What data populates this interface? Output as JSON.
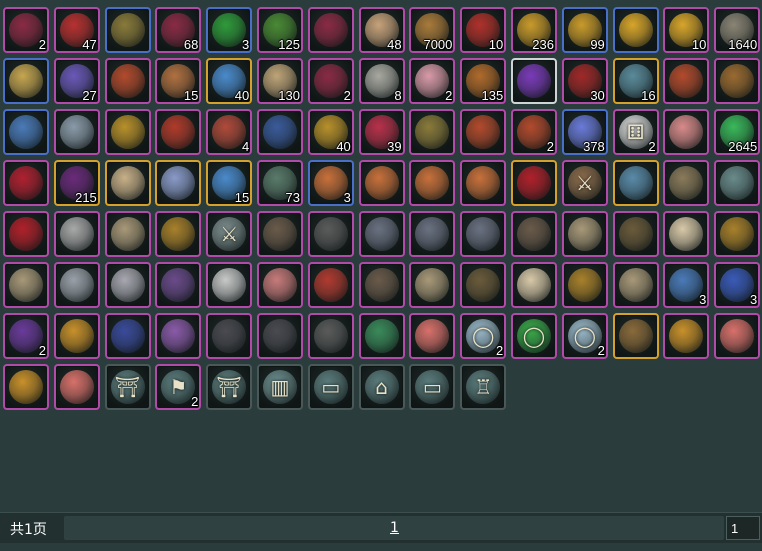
{
  "inventory": {
    "rows": [
      [
        {
          "icon": "purple-seal-icon",
          "quality": "purple",
          "qty": "2"
        },
        {
          "icon": "red-pills-icon",
          "quality": "purple",
          "qty": "47"
        },
        {
          "icon": "scroll-bundle-icon",
          "quality": "blue",
          "qty": ""
        },
        {
          "icon": "purple-seal-icon",
          "quality": "purple",
          "qty": "68"
        },
        {
          "icon": "green-orb-icon",
          "quality": "blue",
          "qty": "3"
        },
        {
          "icon": "herb-sprig-icon",
          "quality": "purple",
          "qty": "125"
        },
        {
          "icon": "purple-seal-icon",
          "quality": "purple",
          "qty": ""
        },
        {
          "icon": "paper-note-icon",
          "quality": "purple",
          "qty": "48"
        },
        {
          "icon": "coin-pouch-icon",
          "quality": "purple",
          "qty": "7000"
        },
        {
          "icon": "red-envelope-icon",
          "quality": "purple",
          "qty": "10"
        },
        {
          "icon": "gold-nuggets-icon",
          "quality": "purple",
          "qty": "236"
        },
        {
          "icon": "gold-nuggets-icon",
          "quality": "blue",
          "qty": "99"
        },
        {
          "icon": "gold-ingot-icon",
          "quality": "blue",
          "qty": ""
        },
        {
          "icon": "gold-ingot-icon",
          "quality": "purple",
          "qty": "10"
        },
        {
          "icon": "stone-block-icon",
          "quality": "purple",
          "qty": "1640"
        }
      ],
      [
        {
          "icon": "flower-wreath-icon",
          "quality": "blue",
          "qty": ""
        },
        {
          "icon": "gem-chest-icon",
          "quality": "purple",
          "qty": "27"
        },
        {
          "icon": "red-treasure-chest-icon",
          "quality": "purple",
          "qty": ""
        },
        {
          "icon": "food-plate-icon",
          "quality": "purple",
          "qty": "15"
        },
        {
          "icon": "blue-crystal-icon",
          "quality": "gold",
          "qty": "40"
        },
        {
          "icon": "scroll-icon",
          "quality": "purple",
          "qty": "130"
        },
        {
          "icon": "purple-seal-icon",
          "quality": "purple",
          "qty": "2"
        },
        {
          "icon": "ore-rock-icon",
          "quality": "purple",
          "qty": "8"
        },
        {
          "icon": "lotus-flower-icon",
          "quality": "purple",
          "qty": "2"
        },
        {
          "icon": "elixir-gourd-icon",
          "quality": "purple",
          "qty": "135"
        },
        {
          "icon": "purple-potion-icon",
          "quality": "white",
          "qty": ""
        },
        {
          "icon": "candied-haws-icon",
          "quality": "purple",
          "qty": "30"
        },
        {
          "icon": "rune-stone-icon",
          "quality": "gold",
          "qty": "16"
        },
        {
          "icon": "red-treasure-chest-icon",
          "quality": "purple",
          "qty": ""
        },
        {
          "icon": "wooden-chest-icon",
          "quality": "purple",
          "qty": ""
        }
      ],
      [
        {
          "icon": "blue-scroll-icon",
          "quality": "blue",
          "qty": ""
        },
        {
          "icon": "silver-pouch-icon",
          "quality": "purple",
          "qty": ""
        },
        {
          "icon": "gourd-bottle-icon",
          "quality": "purple",
          "qty": ""
        },
        {
          "icon": "red-bag-icon",
          "quality": "purple",
          "qty": ""
        },
        {
          "icon": "fox-figurine-icon",
          "quality": "purple",
          "qty": "4"
        },
        {
          "icon": "blue-book-icon",
          "quality": "purple",
          "qty": ""
        },
        {
          "icon": "gold-bars-icon",
          "quality": "purple",
          "qty": "40"
        },
        {
          "icon": "red-gift-box-icon",
          "quality": "purple",
          "qty": "39"
        },
        {
          "icon": "scroll-bundle-icon",
          "quality": "purple",
          "qty": ""
        },
        {
          "icon": "red-treasure-chest-icon",
          "quality": "purple",
          "qty": ""
        },
        {
          "icon": "red-treasure-chest-icon",
          "quality": "purple",
          "qty": "2"
        },
        {
          "icon": "incense-burner-icon",
          "quality": "blue",
          "qty": "378"
        },
        {
          "icon": "dice-icon",
          "quality": "purple",
          "qty": "2"
        },
        {
          "icon": "pink-fish-icon",
          "quality": "purple",
          "qty": ""
        },
        {
          "icon": "jade-bowl-icon",
          "quality": "purple",
          "qty": "2645"
        }
      ],
      [
        {
          "icon": "red-leaf-icon",
          "quality": "purple",
          "qty": ""
        },
        {
          "icon": "gem-shard-icon",
          "quality": "gold",
          "qty": "215"
        },
        {
          "icon": "ancient-scroll-icon",
          "quality": "gold",
          "qty": ""
        },
        {
          "icon": "compass-disc-icon",
          "quality": "gold",
          "qty": ""
        },
        {
          "icon": "blue-crystal-icon",
          "quality": "gold",
          "qty": "15"
        },
        {
          "icon": "stone-mask-icon",
          "quality": "purple",
          "qty": "73"
        },
        {
          "icon": "copper-chest-icon",
          "quality": "blue",
          "qty": "3"
        },
        {
          "icon": "copper-chest-icon",
          "quality": "purple",
          "qty": ""
        },
        {
          "icon": "copper-chest-icon",
          "quality": "purple",
          "qty": ""
        },
        {
          "icon": "copper-chest-icon",
          "quality": "purple",
          "qty": ""
        },
        {
          "icon": "red-claw-weapon-icon",
          "quality": "gold",
          "qty": ""
        },
        {
          "icon": "crossed-blades-icon",
          "quality": "purple",
          "qty": ""
        },
        {
          "icon": "winged-blade-icon",
          "quality": "gold",
          "qty": ""
        },
        {
          "icon": "spiked-weapon-icon",
          "quality": "purple",
          "qty": ""
        },
        {
          "icon": "dagger-icon",
          "quality": "purple",
          "qty": ""
        }
      ],
      [
        {
          "icon": "red-claw-weapon-icon",
          "quality": "purple",
          "qty": ""
        },
        {
          "icon": "spiked-armor-icon",
          "quality": "purple",
          "qty": ""
        },
        {
          "icon": "shoulder-armor-icon",
          "quality": "purple",
          "qty": ""
        },
        {
          "icon": "gold-helmet-icon",
          "quality": "purple",
          "qty": ""
        },
        {
          "icon": "sword-icon",
          "quality": "purple",
          "qty": ""
        },
        {
          "icon": "arm-guard-icon",
          "quality": "purple",
          "qty": ""
        },
        {
          "icon": "dark-belt-icon",
          "quality": "purple",
          "qty": ""
        },
        {
          "icon": "curved-blade-icon",
          "quality": "purple",
          "qty": ""
        },
        {
          "icon": "curved-blade-icon",
          "quality": "purple",
          "qty": ""
        },
        {
          "icon": "curved-blade-icon",
          "quality": "purple",
          "qty": ""
        },
        {
          "icon": "arm-guard-icon",
          "quality": "purple",
          "qty": ""
        },
        {
          "icon": "shoulder-armor-icon",
          "quality": "purple",
          "qty": ""
        },
        {
          "icon": "boots-icon",
          "quality": "purple",
          "qty": ""
        },
        {
          "icon": "white-robe-icon",
          "quality": "purple",
          "qty": ""
        },
        {
          "icon": "gold-bracelet-icon",
          "quality": "purple",
          "qty": ""
        }
      ],
      [
        {
          "icon": "shoulder-armor-icon",
          "quality": "purple",
          "qty": ""
        },
        {
          "icon": "leg-guards-icon",
          "quality": "purple",
          "qty": ""
        },
        {
          "icon": "silver-pauldron-icon",
          "quality": "purple",
          "qty": ""
        },
        {
          "icon": "purple-robe-icon",
          "quality": "purple",
          "qty": ""
        },
        {
          "icon": "white-tunic-icon",
          "quality": "purple",
          "qty": ""
        },
        {
          "icon": "pink-gauntlet-icon",
          "quality": "purple",
          "qty": ""
        },
        {
          "icon": "red-belt-icon",
          "quality": "purple",
          "qty": ""
        },
        {
          "icon": "arm-guard-icon",
          "quality": "purple",
          "qty": ""
        },
        {
          "icon": "shoulder-armor-icon",
          "quality": "purple",
          "qty": ""
        },
        {
          "icon": "boots-icon",
          "quality": "purple",
          "qty": ""
        },
        {
          "icon": "white-robe-icon",
          "quality": "purple",
          "qty": ""
        },
        {
          "icon": "gold-bracelet-icon",
          "quality": "purple",
          "qty": ""
        },
        {
          "icon": "shoulder-armor-icon",
          "quality": "purple",
          "qty": ""
        },
        {
          "icon": "porcelain-vase-icon",
          "quality": "purple",
          "qty": "3"
        },
        {
          "icon": "blue-vase-icon",
          "quality": "purple",
          "qty": "3"
        }
      ],
      [
        {
          "icon": "purple-pouch-icon",
          "quality": "purple",
          "qty": "2"
        },
        {
          "icon": "gold-pouch-icon",
          "quality": "purple",
          "qty": ""
        },
        {
          "icon": "blue-box-icon",
          "quality": "purple",
          "qty": ""
        },
        {
          "icon": "purple-bow-icon",
          "quality": "purple",
          "qty": ""
        },
        {
          "icon": "dark-armor-icon",
          "quality": "purple",
          "qty": ""
        },
        {
          "icon": "dark-armor-icon",
          "quality": "purple",
          "qty": ""
        },
        {
          "icon": "dark-belt-icon",
          "quality": "purple",
          "qty": ""
        },
        {
          "icon": "jade-necklace-icon",
          "quality": "purple",
          "qty": ""
        },
        {
          "icon": "pink-fan-icon",
          "quality": "purple",
          "qty": ""
        },
        {
          "icon": "silver-ring-icon",
          "quality": "purple",
          "qty": "2"
        },
        {
          "icon": "green-ring-icon",
          "quality": "purple",
          "qty": ""
        },
        {
          "icon": "silver-ring-icon",
          "quality": "purple",
          "qty": "2"
        },
        {
          "icon": "bronze-plate-icon",
          "quality": "gold",
          "qty": ""
        },
        {
          "icon": "gold-pouch-icon",
          "quality": "purple",
          "qty": ""
        },
        {
          "icon": "pink-fan-icon",
          "quality": "purple",
          "qty": ""
        }
      ],
      [
        {
          "icon": "gold-pouch-icon",
          "quality": "purple",
          "qty": ""
        },
        {
          "icon": "pink-fan-icon",
          "quality": "purple",
          "qty": ""
        },
        {
          "icon": "gate-arch-icon",
          "quality": "dark",
          "qty": ""
        },
        {
          "icon": "banner-flag-icon",
          "quality": "purple",
          "qty": "2"
        },
        {
          "icon": "gate-arch-icon",
          "quality": "dark",
          "qty": ""
        },
        {
          "icon": "folding-screen-icon",
          "quality": "dark",
          "qty": ""
        },
        {
          "icon": "table-icon",
          "quality": "dark",
          "qty": ""
        },
        {
          "icon": "altar-icon",
          "quality": "dark",
          "qty": ""
        },
        {
          "icon": "table-icon",
          "quality": "dark",
          "qty": ""
        },
        {
          "icon": "chair-icon",
          "quality": "dark",
          "qty": ""
        }
      ]
    ],
    "palette": {
      "purple-seal-icon": "#8a2a44",
      "red-pills-icon": "#b83030",
      "scroll-bundle-icon": "#8a7a3a",
      "green-orb-icon": "#2f9a3a",
      "herb-sprig-icon": "#4a8a34",
      "paper-note-icon": "#c7a27a",
      "coin-pouch-icon": "#a97a3a",
      "red-envelope-icon": "#b0302a",
      "gold-nuggets-icon": "#c99a2a",
      "gold-ingot-icon": "#d8a52a",
      "stone-block-icon": "#8a8474",
      "flower-wreath-icon": "#c6a650",
      "gem-chest-icon": "#6a58b8",
      "red-treasure-chest-icon": "#b24a2c",
      "food-plate-icon": "#b07040",
      "blue-crystal-icon": "#4a8acb",
      "scroll-icon": "#bfa478",
      "ore-rock-icon": "#a8a8a0",
      "lotus-flower-icon": "#d89aa8",
      "elixir-gourd-icon": "#b06a2a",
      "purple-potion-icon": "#7a3ab8",
      "candied-haws-icon": "#a02828",
      "rune-stone-icon": "#5a8a9a",
      "wooden-chest-icon": "#9a6a30",
      "blue-scroll-icon": "#4a7ab8",
      "silver-pouch-icon": "#8a9aa8",
      "gourd-bottle-icon": "#b8902a",
      "red-bag-icon": "#b03a2a",
      "fox-figurine-icon": "#b04a3a",
      "blue-book-icon": "#3a5a9a",
      "gold-bars-icon": "#b8902a",
      "red-gift-box-icon": "#b8304a",
      "incense-burner-icon": "#6a7ad8",
      "dice-icon": "#d8d8d8",
      "pink-fish-icon": "#d88a8a",
      "jade-bowl-icon": "#3ab85a",
      "red-leaf-icon": "#b02030",
      "gem-shard-icon": "#6a2a7a",
      "ancient-scroll-icon": "#c8b088",
      "compass-disc-icon": "#8a9ac8",
      "stone-mask-icon": "#5a7a6a",
      "copper-chest-icon": "#c8703a",
      "red-claw-weapon-icon": "#b0202a",
      "crossed-blades-icon": "#8a6a4a",
      "winged-blade-icon": "#5a8aa8",
      "spiked-weapon-icon": "#8a7a5a",
      "dagger-icon": "#6a8a8a",
      "spiked-armor-icon": "#a8a8a8",
      "shoulder-armor-icon": "#a89878",
      "gold-helmet-icon": "#a8802a",
      "sword-icon": "#7a8a8a",
      "arm-guard-icon": "#6a5a4a",
      "dark-belt-icon": "#5a5a5a",
      "curved-blade-icon": "#6a7080",
      "boots-icon": "#6a5a3a",
      "white-robe-icon": "#d8c8a8",
      "gold-bracelet-icon": "#a8802a",
      "leg-guards-icon": "#9aa0a8",
      "silver-pauldron-icon": "#a8a8b0",
      "purple-robe-icon": "#6a4a8a",
      "white-tunic-icon": "#c8c8c8",
      "pink-gauntlet-icon": "#c87a7a",
      "red-belt-icon": "#b03a30",
      "porcelain-vase-icon": "#4a7ab8",
      "blue-vase-icon": "#3a5ab8",
      "purple-pouch-icon": "#6a3a9a",
      "gold-pouch-icon": "#c8902a",
      "blue-box-icon": "#3a4a9a",
      "purple-bow-icon": "#8a5aa8",
      "dark-armor-icon": "#4a4a50",
      "jade-necklace-icon": "#3a8a5a",
      "pink-fan-icon": "#d8706a",
      "silver-ring-icon": "#9ab8c8",
      "green-ring-icon": "#3aa84a",
      "bronze-plate-icon": "#8a6a3a",
      "gate-arch-icon": "#5a7a7a",
      "banner-flag-icon": "#5a7a7a",
      "folding-screen-icon": "#6a8a8a",
      "table-icon": "#5a7a7a",
      "altar-icon": "#5a7a7a",
      "chair-icon": "#5a7a7a"
    },
    "glyphs": {
      "gate-arch-icon": "⛩",
      "banner-flag-icon": "⚑",
      "folding-screen-icon": "▥",
      "table-icon": "▭",
      "altar-icon": "⌂",
      "chair-icon": "♖",
      "dice-icon": "⚅",
      "sword-icon": "⚔",
      "crossed-blades-icon": "⚔",
      "silver-ring-icon": "◯",
      "green-ring-icon": "◯"
    }
  },
  "pagination": {
    "total_label": "共1页",
    "current_page": "1",
    "page_input_value": "1"
  }
}
